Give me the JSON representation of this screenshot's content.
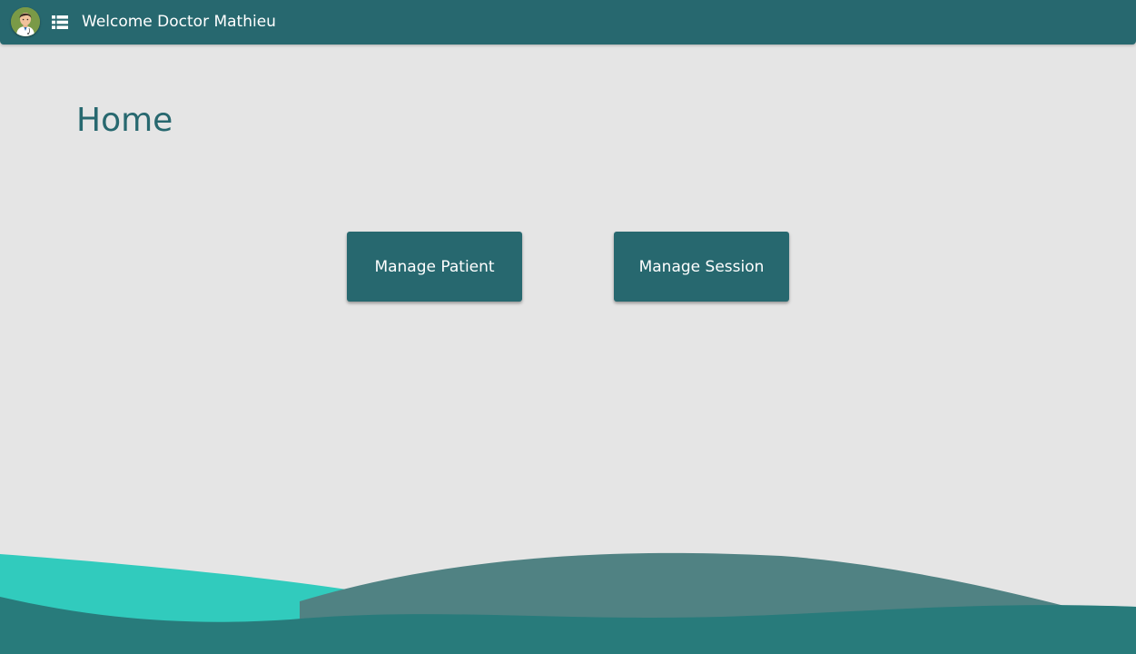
{
  "header": {
    "welcome_text": "Welcome Doctor Mathieu",
    "avatar_icon": "doctor-avatar-icon",
    "menu_icon": "list-menu-icon"
  },
  "main": {
    "title": "Home",
    "buttons": {
      "manage_patient": "Manage Patient",
      "manage_session": "Manage Session"
    }
  },
  "colors": {
    "primary": "#27686f",
    "background": "#e5e5e5",
    "wave_light": "#31cbbd",
    "wave_mid": "#508283",
    "wave_dark": "#287b7b"
  }
}
